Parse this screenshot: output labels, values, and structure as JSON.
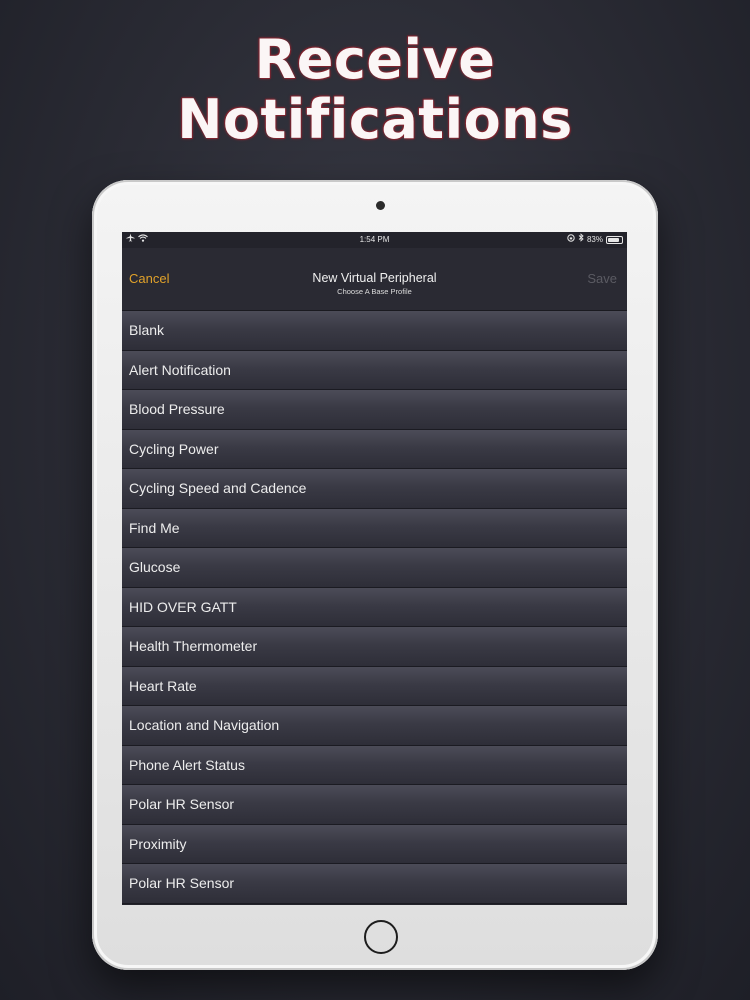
{
  "headline": {
    "line1": "Receive",
    "line2": "Notifications"
  },
  "status_bar": {
    "time": "1:54 PM",
    "battery_percent": "83%",
    "battery_level": 0.83,
    "icons_left": [
      "airplane-icon",
      "wifi-icon"
    ],
    "icons_right": [
      "lock-rotation-icon",
      "bluetooth-icon",
      "battery-icon"
    ]
  },
  "nav": {
    "cancel_label": "Cancel",
    "title": "New Virtual Peripheral",
    "subtitle": "Choose A Base Profile",
    "save_label": "Save",
    "cancel_color": "#e0a12a",
    "save_color": "#5b5b63"
  },
  "profiles": [
    "Blank",
    "Alert Notification",
    "Blood Pressure",
    "Cycling Power",
    "Cycling Speed and Cadence",
    "Find Me",
    "Glucose",
    "HID OVER GATT",
    "Health Thermometer",
    "Heart Rate",
    "Location and Navigation",
    "Phone Alert Status",
    "Polar HR Sensor",
    "Proximity",
    "Polar HR Sensor"
  ],
  "colors": {
    "background": "#2a2b34",
    "screen": "#23232b",
    "row_top": "#4c4c58",
    "row_bottom": "#2e2e38",
    "headline_glow": "#8a2a35"
  }
}
